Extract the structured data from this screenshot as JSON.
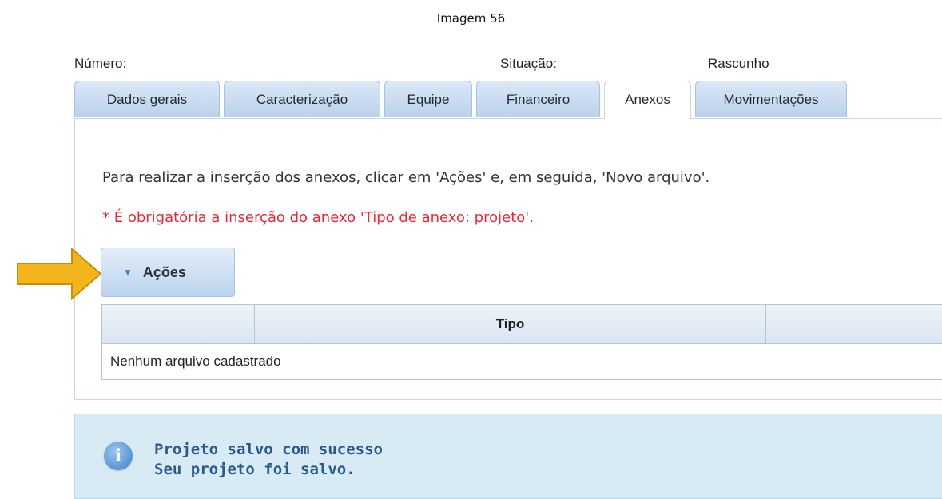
{
  "caption": "Imagem 56",
  "header": {
    "numero_label": "Número:",
    "situacao_label": "Situação:",
    "situacao_value": "Rascunho"
  },
  "tabs": [
    {
      "label": "Dados gerais"
    },
    {
      "label": "Caracterização"
    },
    {
      "label": "Equipe"
    },
    {
      "label": "Financeiro"
    },
    {
      "label": "Anexos",
      "active": true
    },
    {
      "label": "Movimentações"
    }
  ],
  "panel": {
    "instruction": "Para realizar a inserção dos anexos, clicar em 'Ações' e, em seguida, 'Novo arquivo'.",
    "required_note": "* É obrigatória a inserção do anexo 'Tipo de anexo: projeto'.",
    "actions_label": "Ações",
    "table": {
      "columns": [
        "",
        "Tipo",
        ""
      ],
      "empty_row": "Nenhum arquivo cadastrado"
    }
  },
  "message": {
    "title": "Projeto salvo com sucesso",
    "body": "Seu projeto foi salvo.",
    "icon": "info-icon"
  },
  "colors": {
    "arrow": "#f2b51b",
    "required": "#e8283a",
    "message_bg": "#d8ebf5"
  }
}
